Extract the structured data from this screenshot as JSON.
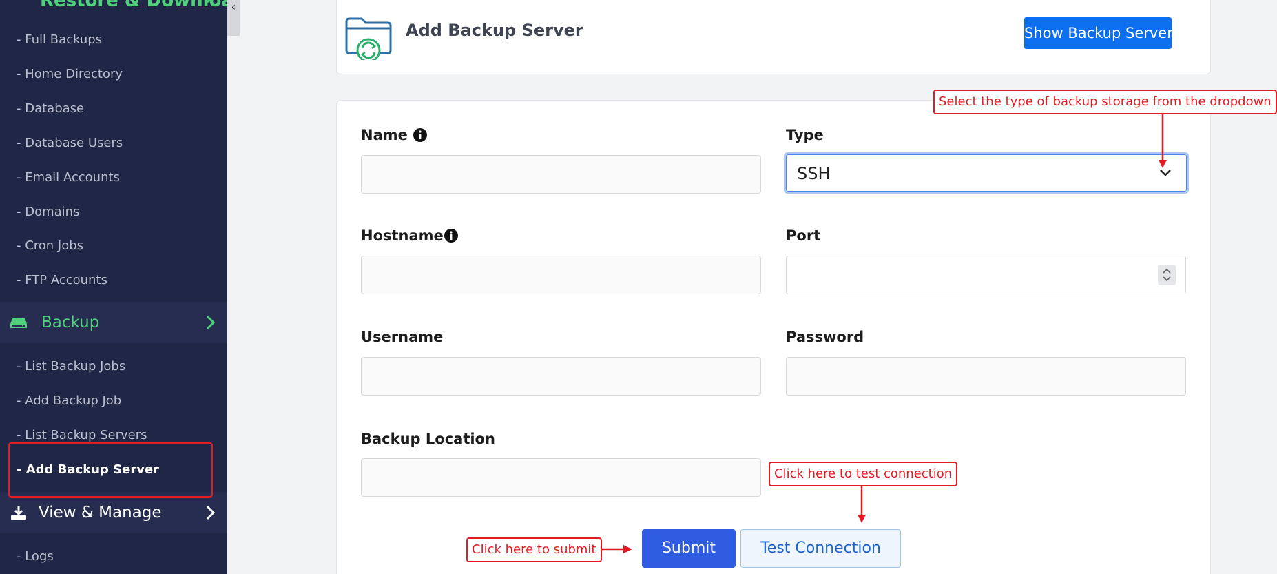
{
  "sidebar": {
    "top_cut_label": "Restore & Download",
    "group1_items": [
      {
        "label": "- Full Backups"
      },
      {
        "label": "- Home Directory"
      },
      {
        "label": "- Database"
      },
      {
        "label": "- Database Users"
      },
      {
        "label": "- Email Accounts"
      },
      {
        "label": "- Domains"
      },
      {
        "label": "- Cron Jobs"
      },
      {
        "label": "- FTP Accounts"
      }
    ],
    "backup_section": {
      "label": "Backup",
      "icon": "hdd-icon",
      "color": "#4fd17b"
    },
    "group2_items": [
      {
        "label": "- List Backup Jobs"
      },
      {
        "label": "- Add Backup Job"
      },
      {
        "label": "- List Backup Servers"
      },
      {
        "label": "- Add Backup Server"
      }
    ],
    "view_section": {
      "label": "View & Manage",
      "icon": "download-icon"
    },
    "group3_items": [
      {
        "label": "- Logs"
      }
    ],
    "collapse_glyph": "‹"
  },
  "header": {
    "title": "Add Backup Server",
    "show_button": "Show Backup Servers",
    "accent": "#0b6ff0"
  },
  "form": {
    "name_label": "Name",
    "type_label": "Type",
    "type_value": "SSH",
    "hostname_label": "Hostname",
    "port_label": "Port",
    "username_label": "Username",
    "password_label": "Password",
    "location_label": "Backup Location",
    "submit_label": "Submit",
    "test_label": "Test Connection"
  },
  "annotations": {
    "type_hint": "Select the type of backup storage from the dropdown",
    "test_hint": "Click here to test connection",
    "submit_hint": "Click here to submit",
    "color": "#e41b23"
  }
}
